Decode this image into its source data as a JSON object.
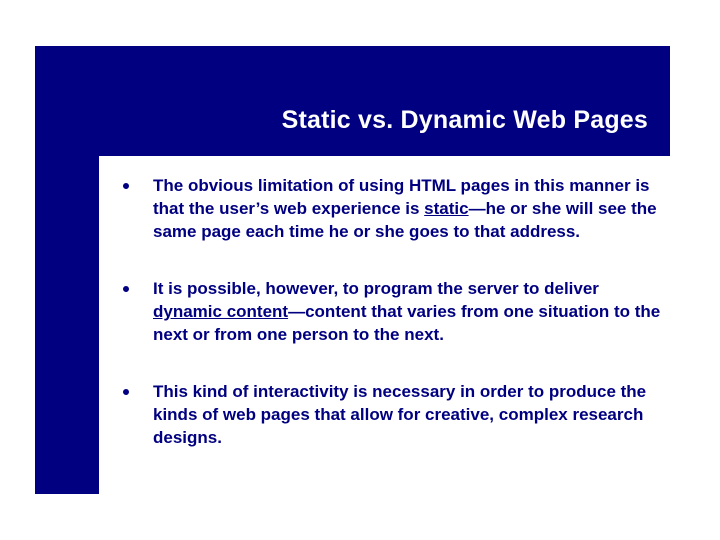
{
  "title": "Static vs. Dynamic Web Pages",
  "bullets": {
    "b1": {
      "pre": "The obvious limitation of using HTML pages in this manner is that the user’s web experience is ",
      "u": "static",
      "post": "—he or she will see the same page each time he or she goes to that address."
    },
    "b2": {
      "pre": "It is possible, however, to program the server to deliver ",
      "u": "dynamic content",
      "post": "—content that varies from one situation to the next or from one person to the next."
    },
    "b3": {
      "text": "This kind of interactivity is necessary in order to produce the kinds of web pages that allow for creative, complex research designs."
    }
  }
}
